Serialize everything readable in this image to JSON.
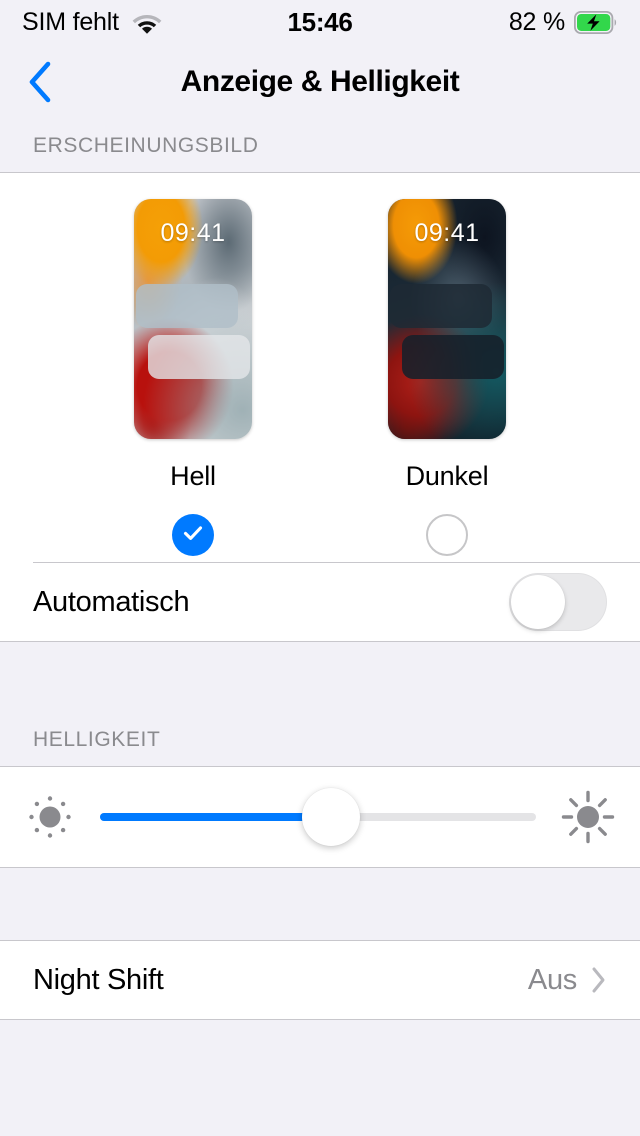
{
  "status_bar": {
    "carrier": "SIM fehlt",
    "wifi_icon": "wifi-icon",
    "time": "15:46",
    "battery_percent": "82 %",
    "battery_icon": "battery-charging-icon"
  },
  "nav": {
    "back_icon": "chevron-left-icon",
    "title": "Anzeige & Helligkeit"
  },
  "appearance": {
    "section_header": "ERSCHEINUNGSBILD",
    "options": [
      {
        "label": "Hell",
        "preview_time": "09:41",
        "selected": true
      },
      {
        "label": "Dunkel",
        "preview_time": "09:41",
        "selected": false
      }
    ],
    "automatic": {
      "label": "Automatisch",
      "toggle_state": "off"
    }
  },
  "brightness": {
    "section_header": "HELLIGKEIT",
    "low_icon": "sun-low-icon",
    "high_icon": "sun-high-icon",
    "value_percent": 53
  },
  "night_shift": {
    "label": "Night Shift",
    "value": "Aus",
    "chevron_icon": "chevron-right-icon"
  },
  "colors": {
    "accent": "#007AFF",
    "group_background": "#F2F1F7",
    "cell_background": "#FFFFFF",
    "separator": "#C8C7CC",
    "secondary_label": "#8A8A8E",
    "battery_green": "#32D74B"
  }
}
